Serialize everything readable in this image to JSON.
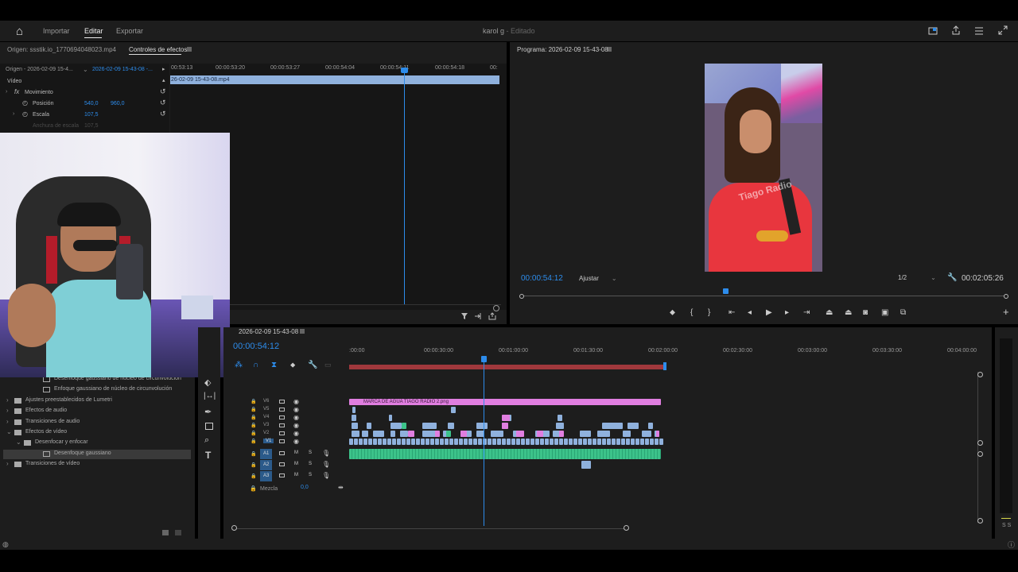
{
  "topbar": {
    "home": "⌂",
    "tabs": [
      "Importar",
      "Editar",
      "Exportar"
    ],
    "project_title": "karol g",
    "project_status": "- Editado"
  },
  "source_panel": {
    "tabs": [
      "Origen: ssstik.io_1770694048023.mp4",
      "Controles de efectos"
    ],
    "clip_selector": "Origen - 2026-02-09 15-4...",
    "sequence_selector": "2026-02-09 15-43-08 -...",
    "ruler": [
      "00:53:13",
      "00:00:53:20",
      "00:00:53:27",
      "00:00:54:04",
      "00:00:54:11",
      "00:00:54:18",
      "00:"
    ],
    "clip_name": "26-02-09 15-43-08.mp4",
    "video_header": "Vídeo",
    "motion_label": "Movimiento",
    "position_label": "Posición",
    "position_x": "540,0",
    "position_y": "960,0",
    "scale_label": "Escala",
    "scale_value": "107,5",
    "scale_width_label": "Anchura de escala",
    "scale_width_value": "107,5"
  },
  "program": {
    "title": "Programa: 2026-02-09 15-43-08",
    "timecode": "00:00:54:12",
    "fit": "Ajustar",
    "resolution": "1/2",
    "duration": "00:02:05:26",
    "playhead_fraction": 0.42,
    "watermark": "Tiago Radio"
  },
  "effects_list": [
    {
      "label": "Desenfoque gaussiano de núcleo de circunvolución",
      "indent": 2
    },
    {
      "label": "Enfoque gaussiano de núcleo de circunvolución",
      "indent": 2
    },
    {
      "label": "Ajustes preestablecidos de Lumetri",
      "indent": 0
    },
    {
      "label": "Efectos de audio",
      "indent": 0
    },
    {
      "label": "Transiciones de audio",
      "indent": 0
    },
    {
      "label": "Efectos de vídeo",
      "indent": 0
    },
    {
      "label": "Desenfocar y enfocar",
      "indent": 1
    },
    {
      "label": "Desenfoque gaussiano",
      "indent": 2
    },
    {
      "label": "Transiciones de vídeo",
      "indent": 0
    }
  ],
  "timeline": {
    "sequence_name": "2026-02-09 15-43-08",
    "timecode": "00:00:54:12",
    "ruler": [
      ":00:00",
      "00:00:30:00",
      "00:01:00:00",
      "00:01:30:00",
      "00:02:00:00",
      "00:02:30:00",
      "00:03:00:00",
      "00:03:30:00",
      "00:04:00:00"
    ],
    "video_tracks": [
      "V6",
      "V5",
      "V4",
      "V3",
      "V2",
      "V1"
    ],
    "audio_tracks": [
      "A1",
      "A2",
      "A3"
    ],
    "audio_buttons": [
      "M",
      "S"
    ],
    "mix_label": "Mezcla",
    "mix_value": "0,0",
    "watermark_clip": "MARCA DE AGUA TIAGO RADIO 2.png",
    "level_labels": "S S"
  },
  "colors": {
    "accent": "#2d8ceb",
    "video_clip": "#8fb1dd",
    "graphic_clip": "#e07ee0",
    "audio_clip": "#3cc38a"
  }
}
